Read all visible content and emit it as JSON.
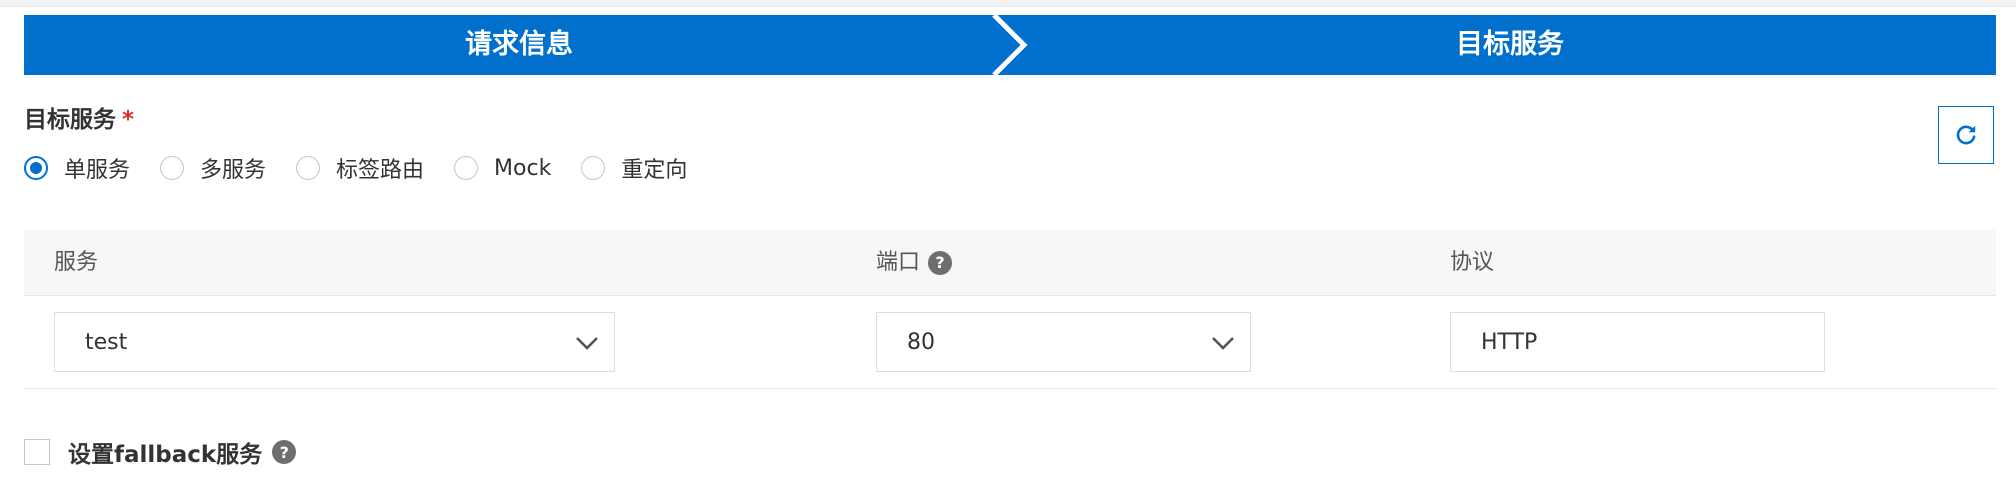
{
  "steps": [
    {
      "label": "请求信息"
    },
    {
      "label": "目标服务"
    }
  ],
  "section": {
    "label": "目标服务",
    "required_mark": "*"
  },
  "radios": [
    {
      "label": "单服务",
      "checked": true
    },
    {
      "label": "多服务",
      "checked": false
    },
    {
      "label": "标签路由",
      "checked": false
    },
    {
      "label": "Mock",
      "checked": false
    },
    {
      "label": "重定向",
      "checked": false
    }
  ],
  "table": {
    "headers": {
      "service": "服务",
      "port": "端口",
      "protocol": "协议"
    },
    "help_glyph": "?",
    "row": {
      "service": "test",
      "port": "80",
      "protocol": "HTTP"
    }
  },
  "fallback": {
    "label": "设置fallback服务",
    "checked": false,
    "help_glyph": "?"
  },
  "colors": {
    "primary": "#0070cc",
    "header_bg": "#f7f7f7",
    "required": "#d93026"
  },
  "icons": {
    "refresh": "refresh-icon",
    "dropdown": "chevron-down-icon",
    "help": "help-icon"
  }
}
